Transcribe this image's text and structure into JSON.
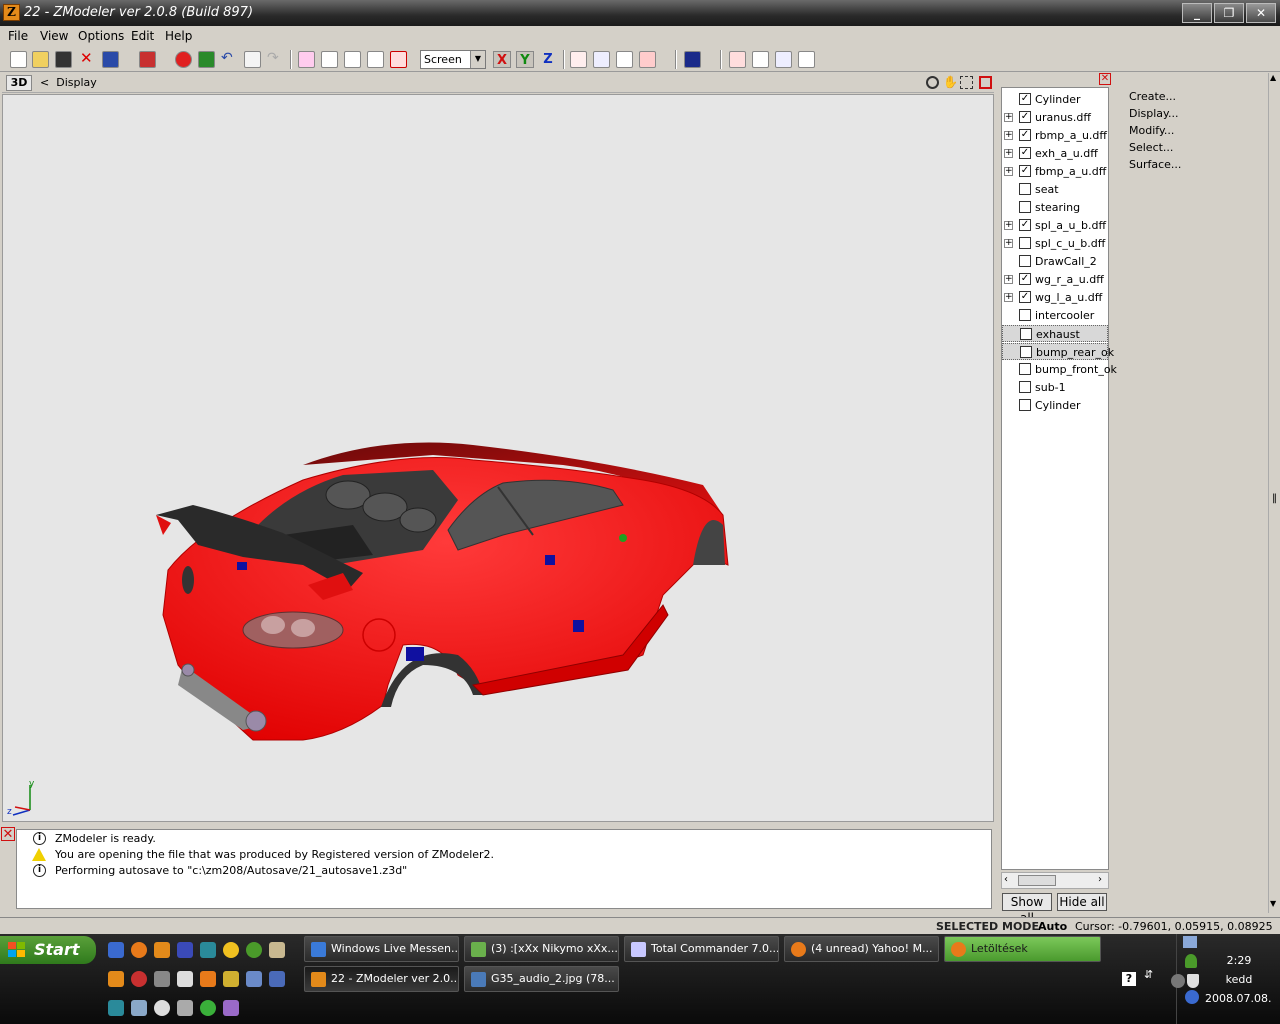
{
  "window": {
    "title": "22 - ZModeler ver 2.0.8 (Build 897)",
    "icon_letter": "Z",
    "controls": [
      "minimize-icon",
      "maximize-icon",
      "close-icon"
    ]
  },
  "menu": [
    "File",
    "View",
    "Options",
    "Edit",
    "Help"
  ],
  "toolbar": {
    "coord_mode": "Screen",
    "axes": {
      "x": "X",
      "y": "Y",
      "z": "Z"
    }
  },
  "viewport": {
    "mode": "3D",
    "crumb_arrow": "<",
    "crumb_label": "Display",
    "axis_y": "y",
    "axis_z": "z",
    "colors": {
      "background": "#e6e6e6",
      "car_body": "#ff1a1a"
    }
  },
  "log": [
    {
      "type": "info",
      "text": "ZModeler is ready."
    },
    {
      "type": "warning",
      "text": "You are opening the file that was produced by Registered version of ZModeler2."
    },
    {
      "type": "info",
      "text": "Performing autosave to \"c:\\zm208/Autosave/21_autosave1.z3d\""
    }
  ],
  "objects": [
    {
      "label": "Cylinder",
      "checked": "✓",
      "expander": ""
    },
    {
      "label": "uranus.dff",
      "checked": "✓",
      "expander": "+"
    },
    {
      "label": "rbmp_a_u.dff",
      "checked": "✓",
      "expander": "+"
    },
    {
      "label": "exh_a_u.dff",
      "checked": "✓",
      "expander": "+"
    },
    {
      "label": "fbmp_a_u.dff",
      "checked": "✓",
      "expander": "+"
    },
    {
      "label": "seat",
      "checked": "",
      "expander": ""
    },
    {
      "label": "stearing",
      "checked": "",
      "expander": ""
    },
    {
      "label": "spl_a_u_b.dff",
      "checked": "✓",
      "expander": "+"
    },
    {
      "label": "spl_c_u_b.dff",
      "checked": "",
      "expander": "+"
    },
    {
      "label": "DrawCall_2",
      "checked": "",
      "expander": ""
    },
    {
      "label": "wg_r_a_u.dff",
      "checked": "✓",
      "expander": "+"
    },
    {
      "label": "wg_l_a_u.dff",
      "checked": "✓",
      "expander": "+"
    },
    {
      "label": "intercooler",
      "checked": "",
      "expander": ""
    },
    {
      "label": "exhaust",
      "checked": "",
      "expander": "",
      "selected": true
    },
    {
      "label": "bump_rear_ok",
      "checked": "",
      "expander": "",
      "selected": true
    },
    {
      "label": "bump_front_ok",
      "checked": "",
      "expander": ""
    },
    {
      "label": "sub-1",
      "checked": "",
      "expander": ""
    },
    {
      "label": "Cylinder",
      "checked": "",
      "expander": ""
    }
  ],
  "tree_buttons": {
    "show_all": "Show all",
    "hide_all": "Hide all"
  },
  "commands": [
    "Create...",
    "Display...",
    "Modify...",
    "Select...",
    "Surface..."
  ],
  "status": {
    "mode": "SELECTED MODE",
    "auto": "Auto",
    "cursor": "Cursor: -0.79601, 0.05915, 0.08925"
  },
  "taskbar": {
    "start": "Start",
    "tasks_row1": [
      {
        "label": "Windows Live Messen...",
        "color": "#3a7ad8"
      },
      {
        "label": "(3) :[xXx Nikymo xXx...",
        "color": "#6ab04c"
      },
      {
        "label": "Total Commander 7.0...",
        "color": "#c8c8ff"
      },
      {
        "label": "(4 unread) Yahoo! M...",
        "color": "#e87a1a"
      },
      {
        "label": "Letöltések",
        "color": "#e87a1a"
      }
    ],
    "tasks_row2": [
      {
        "label": "22 - ZModeler ver 2.0...",
        "color": "#e38a1a"
      },
      {
        "label": "G35_audio_2.jpg (78...",
        "color": "#4a7ab8"
      }
    ],
    "clock": {
      "time": "2:29",
      "day": "kedd",
      "date": "2008.07.08."
    }
  }
}
